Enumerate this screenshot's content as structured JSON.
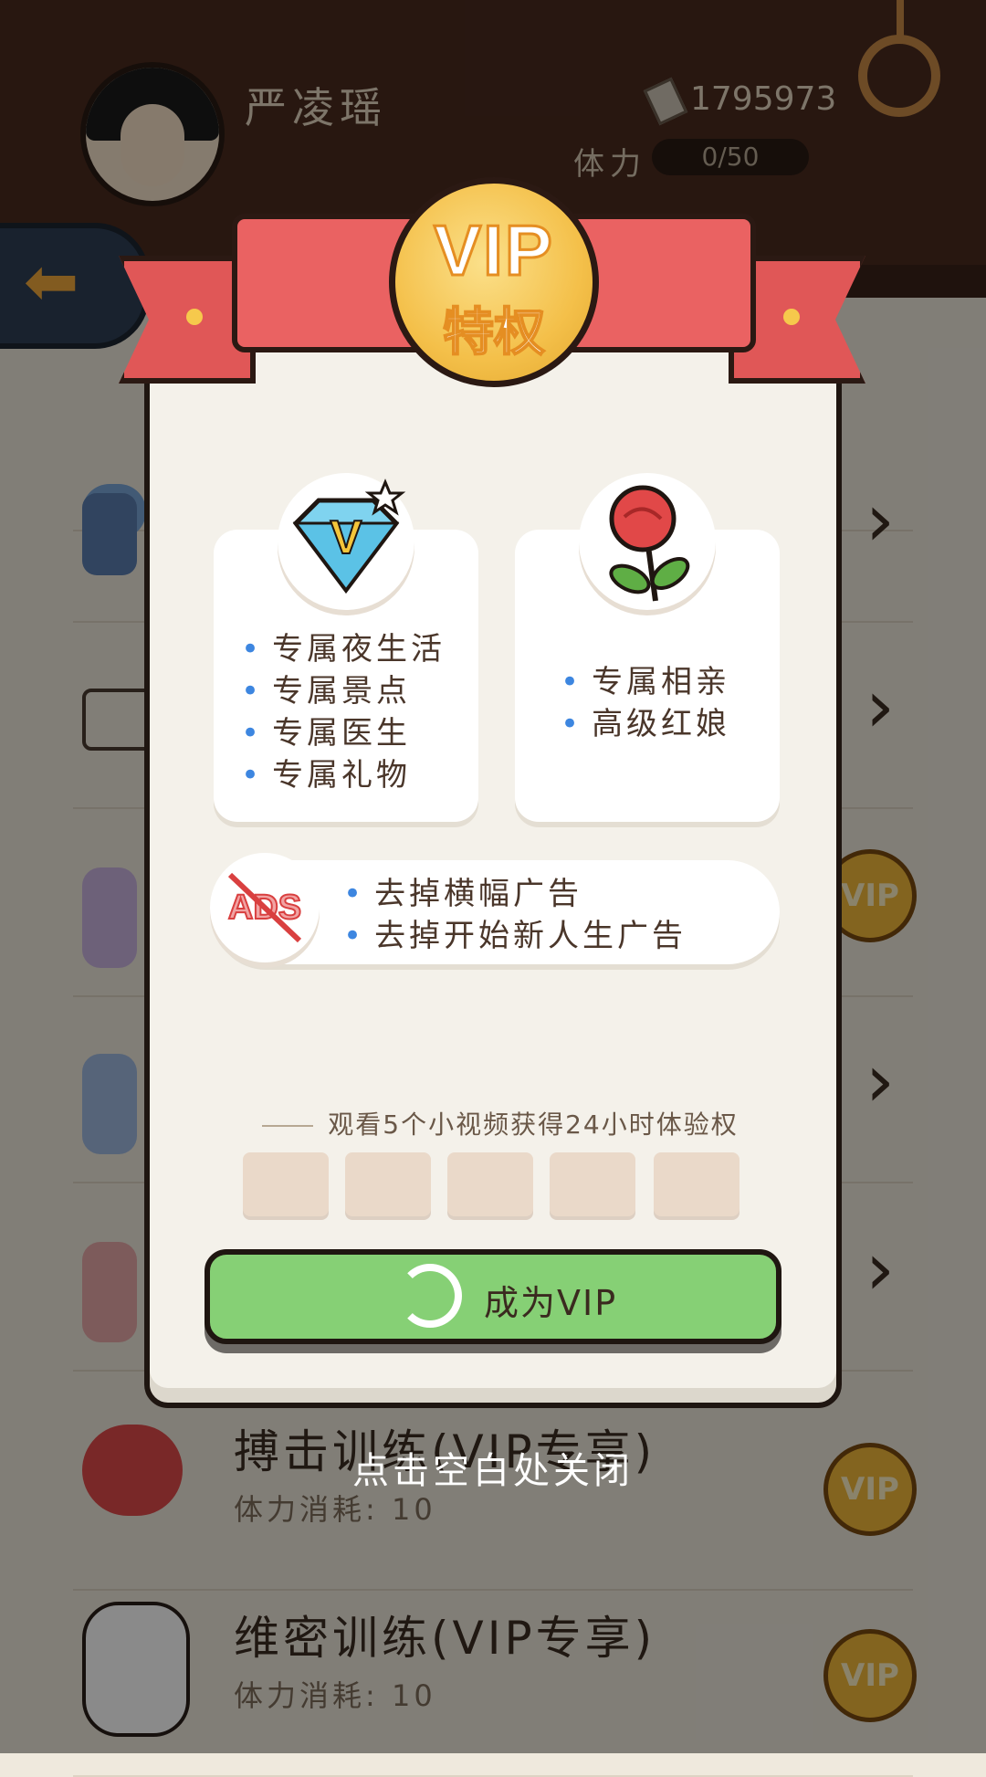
{
  "player": {
    "name": "严凌瑶",
    "money": "1795973",
    "stamina_label": "体力",
    "stamina_value": "0/50"
  },
  "list_items": [
    {
      "title": "",
      "sub": ""
    },
    {
      "title": "",
      "sub": ""
    },
    {
      "title": "",
      "sub": ""
    },
    {
      "title": "",
      "sub": ""
    },
    {
      "title": "",
      "sub": ""
    },
    {
      "title": "搏击训练(VIP专享)",
      "sub": "体力消耗: 10"
    },
    {
      "title": "维密训练(VIP专享)",
      "sub": "体力消耗: 10"
    }
  ],
  "vip_badge": "VIP",
  "close_hint": "点击空白处关闭",
  "modal": {
    "medal_top": "VIP",
    "medal_sub": "特权",
    "card_left": [
      "专属夜生活",
      "专属景点",
      "专属医生",
      "专属礼物"
    ],
    "card_right": [
      "专属相亲",
      "高级红娘"
    ],
    "ads_card": [
      "去掉横幅广告",
      "去掉开始新人生广告"
    ],
    "ads_icon_text": "ADS",
    "video_title": "观看5个小视频获得24小时体验权",
    "video_slots": 5,
    "cta_label": "成为VIP"
  },
  "colors": {
    "ribbon": "#ea6262",
    "cta": "#86d075",
    "medal": "#f4c04a",
    "bullet": "#3d86e0"
  },
  "icons": [
    "diamond-v-icon",
    "rose-icon",
    "no-ads-icon",
    "back-arrow-icon",
    "settings-ring-icon",
    "chevron-right-icon",
    "vip-coin-icon",
    "loading-spinner-icon"
  ]
}
